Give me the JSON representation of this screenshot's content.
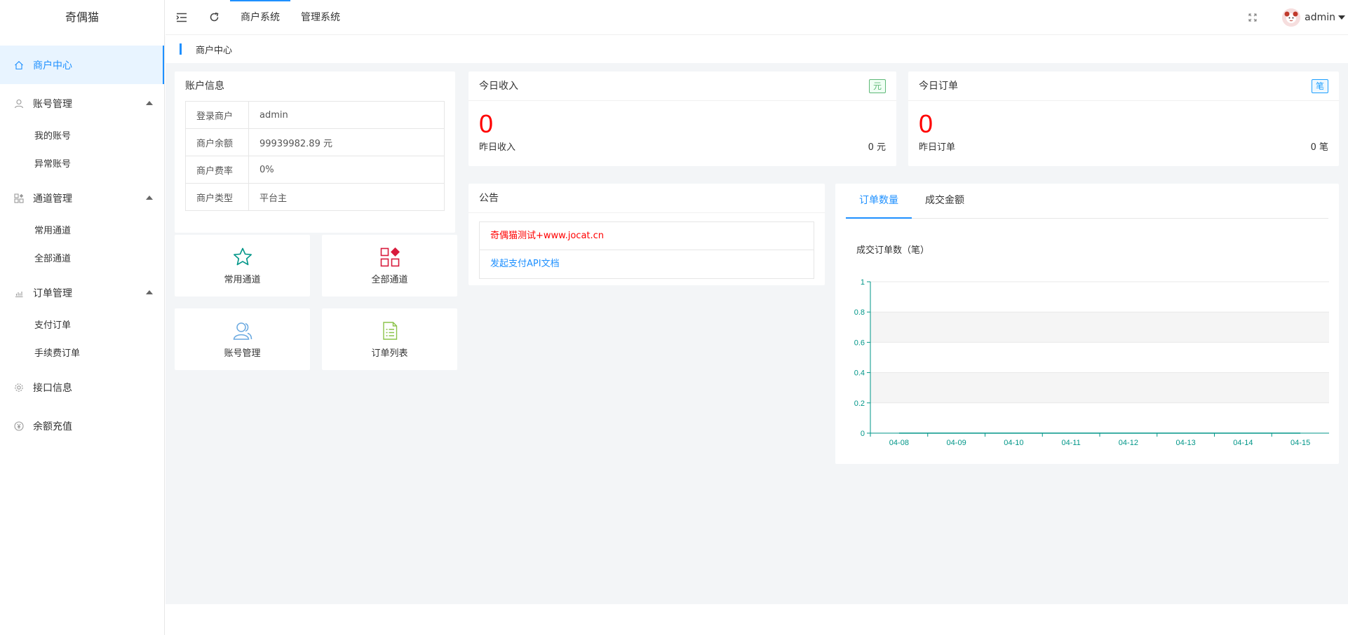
{
  "app": {
    "logo_text": "奇偶猫"
  },
  "sidebar": {
    "items": [
      {
        "label": "商户中心",
        "icon": "home-icon",
        "active": true
      },
      {
        "label": "账号管理",
        "icon": "user-icon",
        "children": [
          "我的账号",
          "异常账号"
        ]
      },
      {
        "label": "通道管理",
        "icon": "apps-icon",
        "children": [
          "常用通道",
          "全部通道"
        ]
      },
      {
        "label": "订单管理",
        "icon": "chart-icon",
        "children": [
          "支付订单",
          "手续费订单"
        ]
      },
      {
        "label": "接口信息",
        "icon": "gear-icon"
      },
      {
        "label": "余额充值",
        "icon": "yen-icon"
      }
    ]
  },
  "header": {
    "nav": [
      "商户系统",
      "管理系统"
    ],
    "active_nav": "商户系统",
    "username": "admin"
  },
  "breadcrumb": {
    "current": "商户中心"
  },
  "account": {
    "title": "账户信息",
    "rows": [
      {
        "key": "登录商户",
        "value": "admin"
      },
      {
        "key": "商户余额",
        "value": "99939982.89 元"
      },
      {
        "key": "商户费率",
        "value": "0%"
      },
      {
        "key": "商户类型",
        "value": "平台主"
      }
    ]
  },
  "shortcuts": [
    {
      "label": "常用通道",
      "icon": "star-icon"
    },
    {
      "label": "全部通道",
      "icon": "grid-icon"
    },
    {
      "label": "账号管理",
      "icon": "users-icon"
    },
    {
      "label": "订单列表",
      "icon": "list-icon"
    }
  ],
  "income": {
    "title": "今日收入",
    "badge": "元",
    "value": "0",
    "yesterday_label": "昨日收入",
    "yesterday_value": "0 元"
  },
  "orders": {
    "title": "今日订单",
    "badge": "笔",
    "value": "0",
    "yesterday_label": "昨日订单",
    "yesterday_value": "0 笔"
  },
  "notice": {
    "title": "公告",
    "items": [
      {
        "text": "奇偶猫测试+www.jocat.cn",
        "color": "#ff0000"
      },
      {
        "text": "发起支付API文档",
        "color": "#1e90ff"
      }
    ]
  },
  "chart_tabs": [
    "订单数量",
    "成交金额"
  ],
  "chart_data": {
    "type": "line",
    "title": "成交订单数（笔）",
    "categories": [
      "04-08",
      "04-09",
      "04-10",
      "04-11",
      "04-12",
      "04-13",
      "04-14",
      "04-15"
    ],
    "values": [
      0,
      0,
      0,
      0,
      0,
      0,
      0,
      0
    ],
    "yticks": [
      "0",
      "0.2",
      "0.4",
      "0.6",
      "0.8",
      "1"
    ],
    "ylim": [
      0,
      1
    ],
    "axis_color": "#009688",
    "grid": true
  },
  "colors": {
    "accent": "#1e90ff",
    "highlight": "#ff0000",
    "axis": "#009688"
  }
}
